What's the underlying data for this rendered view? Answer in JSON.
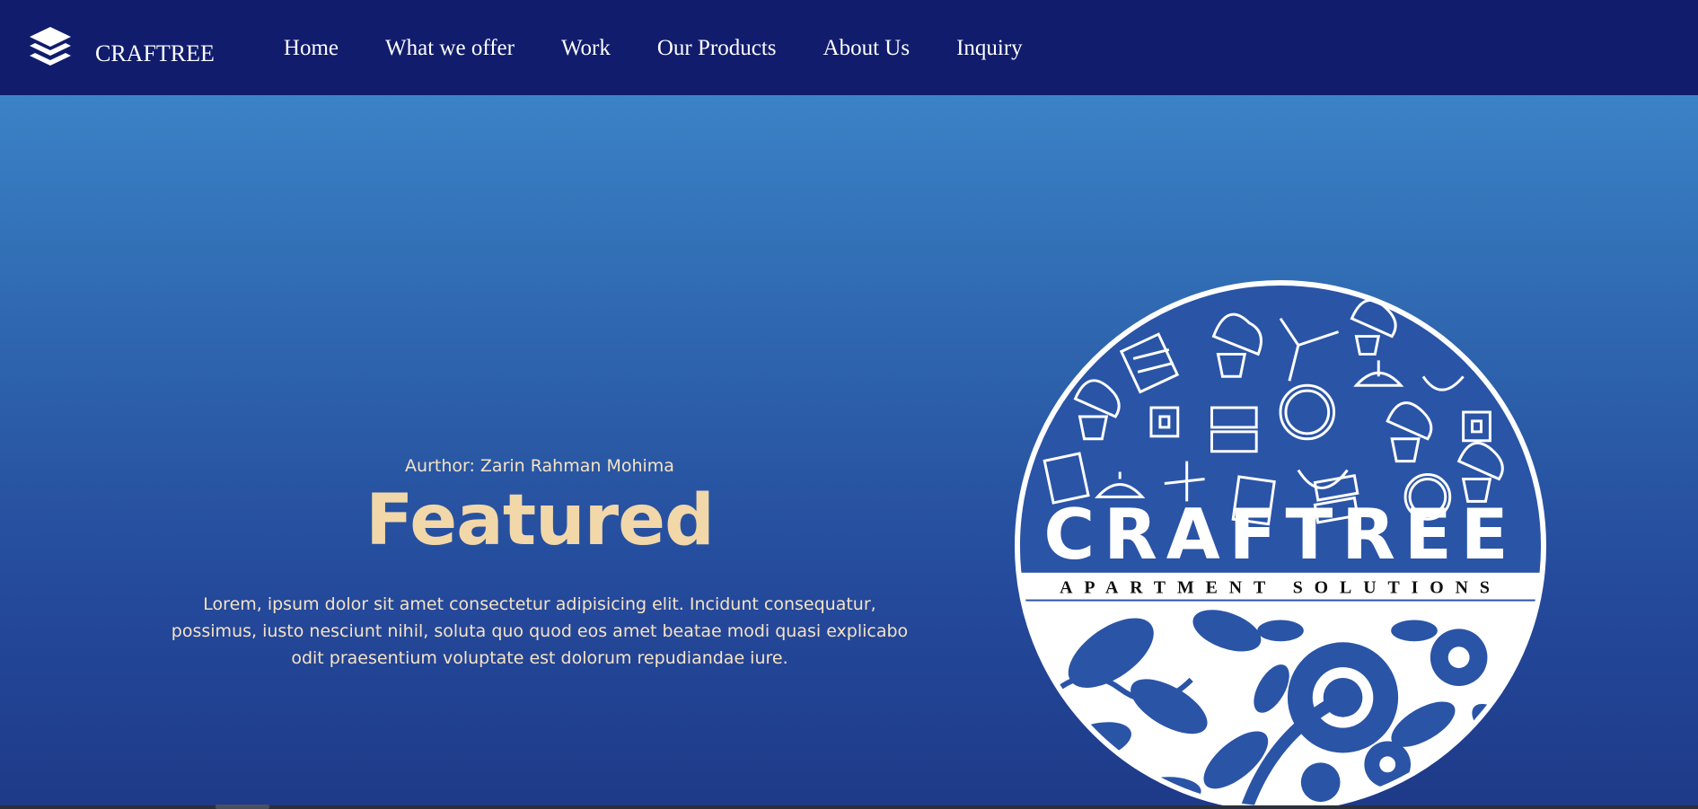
{
  "brand": {
    "name": "CRAFTREE",
    "icon": "layers-stack-icon"
  },
  "nav": {
    "items": [
      {
        "label": "Home"
      },
      {
        "label": "What we offer"
      },
      {
        "label": "Work"
      },
      {
        "label": "Our Products"
      },
      {
        "label": "About Us"
      },
      {
        "label": "Inquiry"
      }
    ]
  },
  "hero": {
    "author": "Aurthor: Zarin Rahman Mohima",
    "heading": "Featured",
    "description": "Lorem, ipsum dolor sit amet consectetur adipisicing elit. Incidunt consequatur, possimus, iusto nesciunt nihil, soluta quo quod eos amet beatae modi quasi explicabo odit praesentium voluptate est dolorum repudiandae iure."
  },
  "logo": {
    "title": "CRAFTREE",
    "subtitle": "APARTMENT SOLUTIONS"
  },
  "colors": {
    "navbar": "#111c6d",
    "hero_top": "#3c82c6",
    "hero_bottom": "#1e3a88",
    "accent_text": "#f2d7a9"
  }
}
